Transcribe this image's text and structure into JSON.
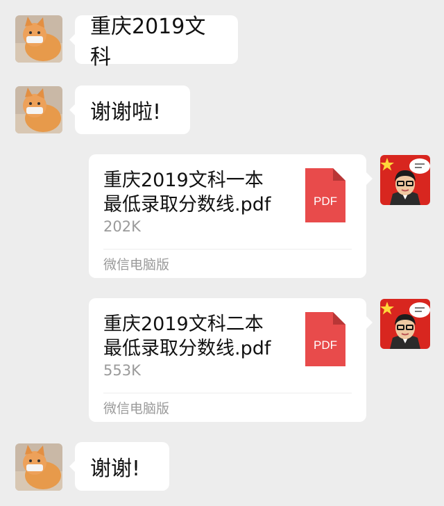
{
  "messages": [
    {
      "text": "重庆2019文科"
    },
    {
      "text": "谢谢啦!"
    },
    {
      "file": {
        "name_line1": "重庆2019文科一本",
        "name_line2": "最低录取分数线.pdf",
        "size": "202K",
        "source": "微信电脑版",
        "icon_label": "PDF"
      }
    },
    {
      "file": {
        "name_line1": "重庆2019文科二本",
        "name_line2": "最低录取分数线.pdf",
        "size": "553K",
        "source": "微信电脑版",
        "icon_label": "PDF"
      }
    },
    {
      "text": "谢谢!"
    }
  ],
  "colors": {
    "background": "#ededed",
    "bubble": "#ffffff",
    "pdf_red": "#e84b4b",
    "secondary_text": "#9a9a9a"
  },
  "icons": {
    "cat_avatar": "cat-photo-avatar",
    "person_avatar": "cartoon-man-flag-avatar",
    "file_icon": "pdf-file-icon"
  }
}
